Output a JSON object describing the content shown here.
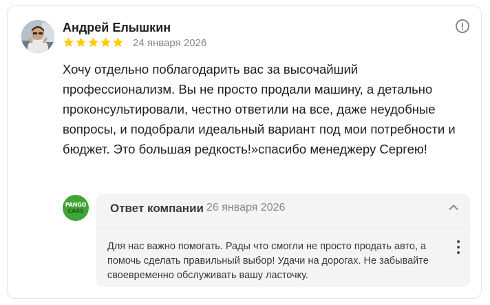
{
  "review": {
    "author": "Андрей Елышкин",
    "rating": 5,
    "rating_max": 5,
    "date": "24 января 2026",
    "text": "Хочу отдельно поблагодарить вас за высочайший профессионализм. Вы не просто продали машину, а детально проконсультировали, честно ответили на все, даже неудобные вопросы, и подобрали идеальный вариант под мои потребности и бюджет. Это большая редкость!»спасибо менеджеру Сергею!",
    "avatar_icon": "user-photo",
    "report_icon": "exclamation-circle-icon"
  },
  "reply": {
    "title": "Ответ компании",
    "date": "26 января 2026",
    "text": "Для нас важно помогать. Рады что смогли не просто продать авто, а помочь сделать правильный выбор! Удачи на дорогах. Не забывайте своевременно обслуживать вашу ласточку.",
    "logo_line1": "PANGO",
    "logo_line2": "CARS",
    "collapse_icon": "chevron-up-icon",
    "menu_icon": "more-vertical-icon"
  },
  "colors": {
    "star": "#ffcc00",
    "logo_bg": "#3fa535",
    "reply_bg": "#f4f4f3",
    "muted_text": "#8a8784"
  }
}
